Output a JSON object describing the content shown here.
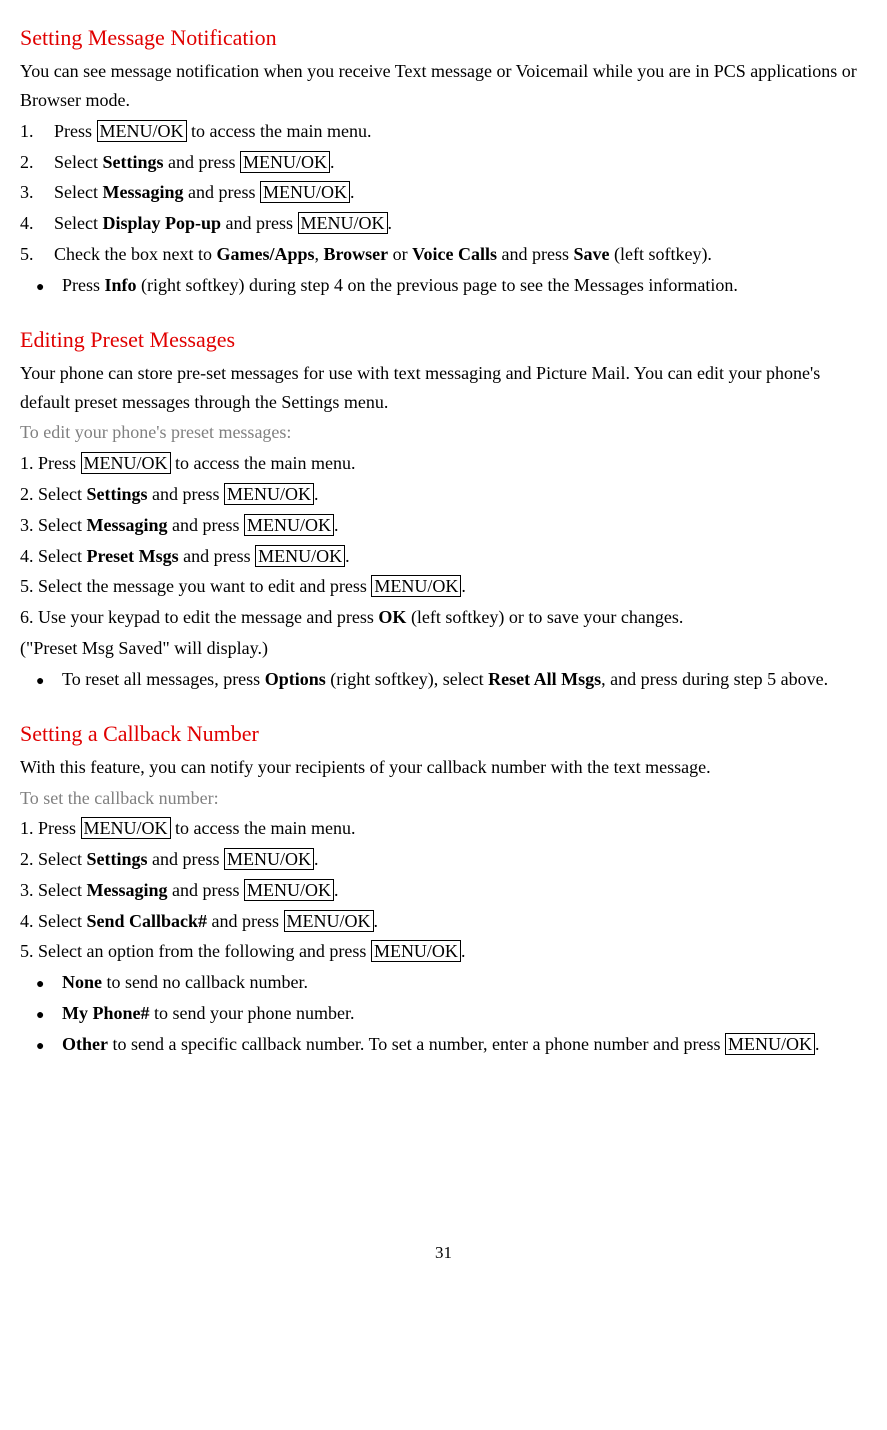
{
  "section1": {
    "heading": "Setting Message Notification",
    "intro": "You can see message notification when you receive Text message or Voicemail while you are in PCS applications or Browser mode.",
    "step1_pre": "Press ",
    "step1_key": "MENU/OK",
    "step1_post": " to access the main menu.",
    "step2_pre": "Select ",
    "step2_bold": "Settings",
    "step2_mid": " and press ",
    "step2_key": "MENU/OK",
    "step2_post": ".",
    "step3_pre": "Select ",
    "step3_bold": "Messaging",
    "step3_mid": " and press ",
    "step3_key": "MENU/OK",
    "step3_post": ".",
    "step4_pre": "Select ",
    "step4_bold": "Display Pop-up",
    "step4_mid": " and press ",
    "step4_key": "MENU/OK",
    "step4_post": ".",
    "step5_pre": "Check the box next to ",
    "step5_b1": "Games/Apps",
    "step5_c1": ", ",
    "step5_b2": "Browser",
    "step5_c2": " or ",
    "step5_b3": "Voice Calls",
    "step5_c3": " and press ",
    "step5_b4": "Save",
    "step5_post": " (left softkey).",
    "bullet1_pre": "Press ",
    "bullet1_bold": "Info",
    "bullet1_post": " (right softkey) during step 4 on the previous page to see the Messages information."
  },
  "section2": {
    "heading": "Editing Preset Messages",
    "intro": "Your phone can store pre-set messages for use with text messaging and Picture Mail. You can edit your phone's default preset messages through the Settings menu.",
    "sub": "To edit your phone's preset messages:",
    "s1_pre": "1. Press ",
    "s1_key": "MENU/OK",
    "s1_post": " to access the main menu.",
    "s2_pre": "2. Select ",
    "s2_bold": "Settings",
    "s2_mid": " and press ",
    "s2_key": "MENU/OK",
    "s2_post": ".",
    "s3_pre": "3. Select ",
    "s3_bold": "Messaging",
    "s3_mid": " and press ",
    "s3_key": "MENU/OK",
    "s3_post": ".",
    "s4_pre": "4. Select ",
    "s4_bold": "Preset Msgs",
    "s4_mid": " and press ",
    "s4_key": "MENU/OK",
    "s4_post": ".",
    "s5_pre": "5. Select the message you want to edit and press ",
    "s5_key": "MENU/OK",
    "s5_post": ".",
    "s6_pre": "6. Use your keypad to edit the message and press ",
    "s6_bold": "OK",
    "s6_post": " (left softkey) or to save your changes.",
    "s6b": "(\"Preset Msg Saved\" will display.)",
    "bullet_pre": "To reset all messages, press ",
    "bullet_b1": "Options",
    "bullet_mid": " (right softkey), select ",
    "bullet_b2": "Reset All Msgs",
    "bullet_post": ", and press during step 5 above."
  },
  "section3": {
    "heading": "Setting a Callback Number",
    "intro": "With this feature, you can notify your recipients of your callback number with the text message.",
    "sub": "To set the callback number:",
    "s1_pre": "1. Press ",
    "s1_key": "MENU/OK",
    "s1_post": " to access the main menu.",
    "s2_pre": "2. Select ",
    "s2_bold": "Settings",
    "s2_mid": " and press ",
    "s2_key": "MENU/OK",
    "s2_post": ".",
    "s3_pre": "3. Select ",
    "s3_bold": "Messaging",
    "s3_mid": " and press ",
    "s3_key": "MENU/OK",
    "s3_post": ".",
    "s4_pre": "4. Select ",
    "s4_bold": "Send Callback#",
    "s4_mid": " and press ",
    "s4_key": "MENU/OK",
    "s4_post": ".",
    "s5_pre": "5. Select an option from the following and press ",
    "s5_key": "MENU/OK",
    "s5_post": ".",
    "b1_bold": "None",
    "b1_post": " to send no callback number.",
    "b2_bold": "My Phone#",
    "b2_post": " to send your phone number.",
    "b3_bold": "Other",
    "b3_mid": " to send a specific callback number. To set a number, enter a phone number and press ",
    "b3_key": "MENU/OK",
    "b3_post": "."
  },
  "page_number": "31"
}
